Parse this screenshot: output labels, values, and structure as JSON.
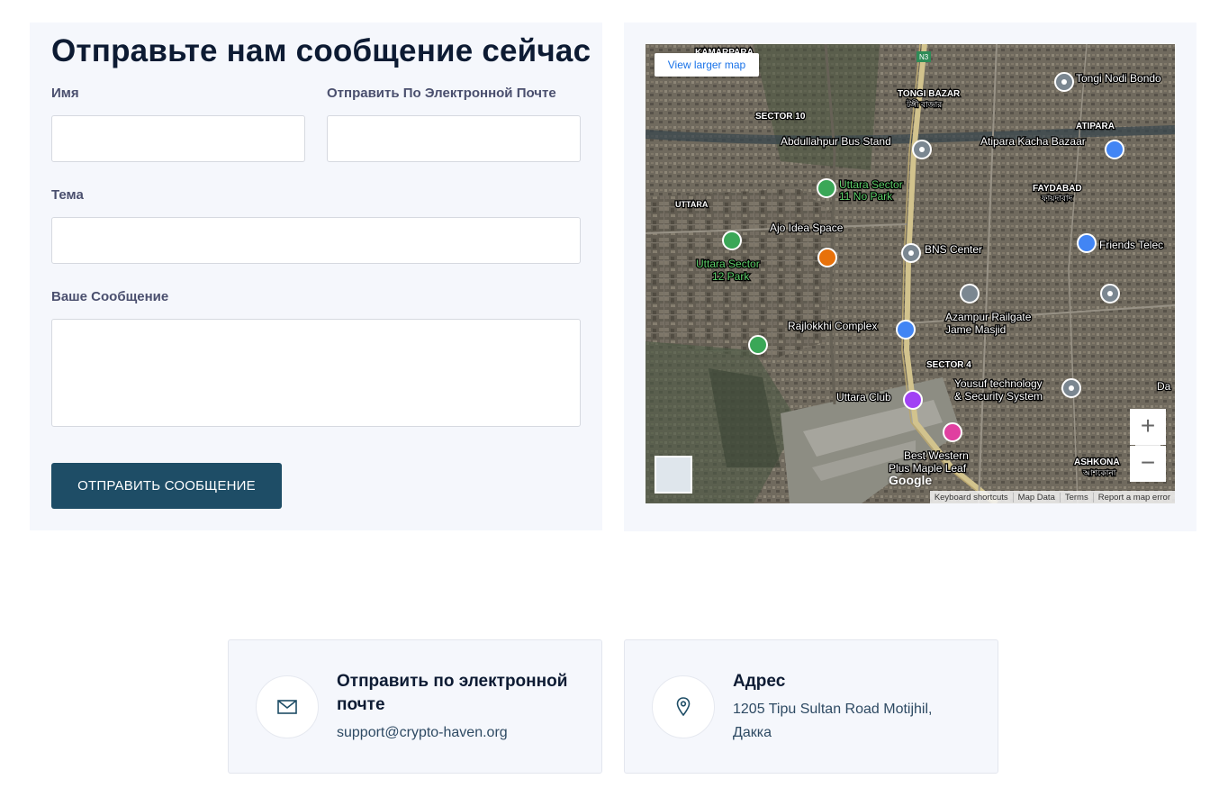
{
  "form": {
    "title": "Отправьте нам сообщение сейчас",
    "name_label": "Имя",
    "email_label": "Отправить По Электронной Почте",
    "subject_label": "Тема",
    "message_label": "Ваше Сообщение",
    "name_value": "",
    "email_value": "",
    "subject_value": "",
    "message_value": "",
    "submit_label": "ОТПРАВИТЬ СООБЩЕНИЕ"
  },
  "map": {
    "view_larger": "View larger map",
    "zoom_in": "+",
    "zoom_out": "−",
    "google_logo": "Google",
    "attribution": [
      "Keyboard shortcuts",
      "Map Data",
      "Terms",
      "Report a map error"
    ],
    "labels": [
      {
        "text": "KAMARPARA"
      },
      {
        "text": "TONGI BAZAR"
      },
      {
        "text": "টঙ্গী বাজার"
      },
      {
        "text": "SECTOR 10"
      },
      {
        "text": "Tongi Nodi Bondo"
      },
      {
        "text": "ATIPARA"
      },
      {
        "text": "Abdullahpur Bus Stand"
      },
      {
        "text": "Atipara Kacha Bazaar"
      },
      {
        "text": "FAYDABAD"
      },
      {
        "text": "ফায়দাবাদ"
      },
      {
        "text": "UTTARA"
      },
      {
        "text": "Uttara Sector"
      },
      {
        "text": "11 No Park"
      },
      {
        "text": "Ajo Idea Space"
      },
      {
        "text": "BNS Center"
      },
      {
        "text": "Friends Telec"
      },
      {
        "text": "Uttara Sector"
      },
      {
        "text": "12 Park"
      },
      {
        "text": "Rajlokkhi Complex"
      },
      {
        "text": "Azampur Railgate"
      },
      {
        "text": "Jame Masjid"
      },
      {
        "text": "SECTOR 4"
      },
      {
        "text": "Yousuf technology"
      },
      {
        "text": "& Security System"
      },
      {
        "text": "Uttara Club"
      },
      {
        "text": "Best Western"
      },
      {
        "text": "Plus Maple Leaf"
      },
      {
        "text": "ASHKONA"
      },
      {
        "text": "আশকোনা"
      },
      {
        "text": "N3"
      },
      {
        "text": "Da"
      }
    ]
  },
  "email_card": {
    "icon": "envelope-icon",
    "title": "Отправить по электронной почте",
    "value": "support@crypto-haven.org"
  },
  "address_card": {
    "icon": "map-pin-icon",
    "title": "Адрес",
    "line1": "1205 Tipu Sultan Road Motijhil,",
    "line2": "Дакка"
  },
  "colors": {
    "card_bg": "#f5f7fc",
    "button_bg": "#1e4d66",
    "title": "#0d1b33",
    "label": "#4a4f6e",
    "link_text": "#2e4a63"
  }
}
